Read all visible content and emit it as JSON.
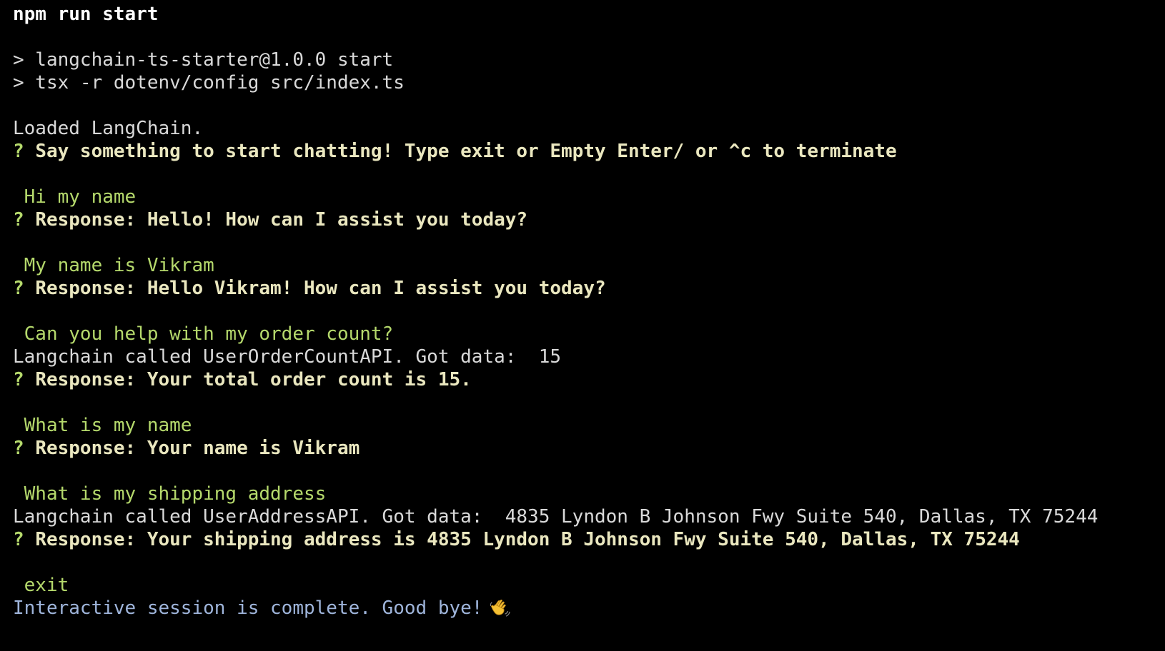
{
  "terminal": {
    "command": "npm run start",
    "script_line_1": "> langchain-ts-starter@1.0.0 start",
    "script_line_2": "> tsx -r dotenv/config src/index.ts",
    "loaded_message": "Loaded LangChain.",
    "prompt_mark": "?",
    "intro_prompt": "Say something to start chatting! Type exit or Empty Enter/ or ^c to terminate",
    "exchanges": [
      {
        "user_input": " Hi my name",
        "api_call": "",
        "response": "Response: Hello! How can I assist you today?"
      },
      {
        "user_input": " My name is Vikram",
        "api_call": "",
        "response": "Response: Hello Vikram! How can I assist you today?"
      },
      {
        "user_input": " Can you help with my order count?",
        "api_call": "Langchain called UserOrderCountAPI. Got data:  15",
        "response": "Response: Your total order count is 15."
      },
      {
        "user_input": " What is my name",
        "api_call": "",
        "response": "Response: Your name is Vikram"
      },
      {
        "user_input": " What is my shipping address",
        "api_call": "Langchain called UserAddressAPI. Got data:  4835 Lyndon B Johnson Fwy Suite 540, Dallas, TX 75244",
        "response": "Response: Your shipping address is 4835 Lyndon B Johnson Fwy Suite 540, Dallas, TX 75244"
      }
    ],
    "exit_input": " exit",
    "session_complete": "Interactive session is complete. Good bye!",
    "farewell_icon": "waving-hand-icon"
  },
  "colors": {
    "background": "#000000",
    "default_text": "#d9d9d9",
    "user_input": "#b5d96c",
    "prompt_text": "#eae7bf",
    "session_complete": "#9fb5db"
  }
}
